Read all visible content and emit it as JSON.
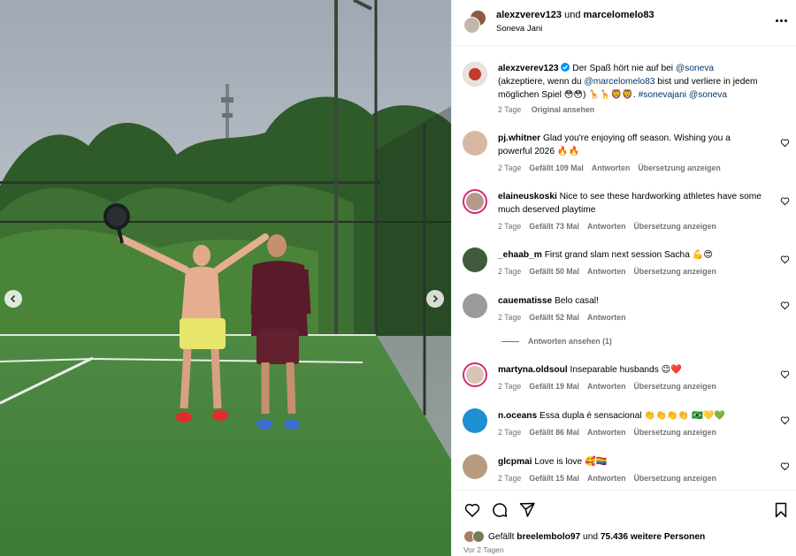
{
  "post": {
    "header": {
      "user1": "alexzverev123",
      "joiner": "und",
      "user2": "marcelomelo83",
      "location": "Soneva Jani"
    },
    "caption": {
      "user": "alexzverev123",
      "text1": "Der Spaß hört nie auf bei",
      "mention1": "@soneva",
      "text2": "(akzeptiere, wenn du",
      "mention2": "@marcelomelo83",
      "text3": "bist und verliere in jedem möglichen Spiel 😳😳) 🦒🦒🦁🦁.",
      "hashtag": "#sonevajani",
      "mention3": "@soneva",
      "time": "2 Tage",
      "action": "Original ansehen"
    },
    "comments": [
      {
        "user": "pj.whitner",
        "text": "Glad you're enjoying off season. Wishing you a powerful 2026 🔥🔥",
        "time": "2 Tage",
        "likes": "Gefällt 109 Mal",
        "reply": "Antworten",
        "translate": "Übersetzung anzeigen"
      },
      {
        "user": "elaineuskoski",
        "text": "Nice to see these hardworking athletes have some much deserved playtime",
        "time": "2 Tage",
        "likes": "Gefällt 73 Mal",
        "reply": "Antworten",
        "translate": "Übersetzung anzeigen"
      },
      {
        "user": "_ehaab_m",
        "text": "First grand slam next session Sacha 💪😍",
        "time": "2 Tage",
        "likes": "Gefällt 50 Mal",
        "reply": "Antworten",
        "translate": "Übersetzung anzeigen"
      },
      {
        "user": "cauematisse",
        "text": "Belo casal!",
        "time": "2 Tage",
        "likes": "Gefällt 52 Mal",
        "reply": "Antworten",
        "translate": ""
      },
      {
        "user": "martyna.oldsoul",
        "text": "Inseparable husbands 😉❤️",
        "time": "2 Tage",
        "likes": "Gefällt 19 Mal",
        "reply": "Antworten",
        "translate": "Übersetzung anzeigen"
      },
      {
        "user": "n.oceans",
        "text": "Essa dupla é sensacional 👏👏👏👏 🇧🇷💛💚",
        "time": "2 Tage",
        "likes": "Gefällt 86 Mal",
        "reply": "Antworten",
        "translate": "Übersetzung anzeigen"
      },
      {
        "user": "glcpmai",
        "text": "Love is love 🥰🏳️‍🌈",
        "time": "2 Tage",
        "likes": "Gefällt 15 Mal",
        "reply": "Antworten",
        "translate": "Übersetzung anzeigen"
      }
    ],
    "view_replies": "Antworten ansehen (1)",
    "footer": {
      "liked_prefix": "Gefällt",
      "liked_user": "breelembolo97",
      "liked_mid": "und",
      "liked_others": "75.436 weitere Personen",
      "date": "Vor 2 Tagen"
    },
    "icons": {
      "like": "heart-icon",
      "comment": "comment-icon",
      "share": "share-icon",
      "save": "bookmark-icon",
      "more": "more-icon",
      "verified": "verified-icon"
    },
    "colors": {
      "link": "#00376b",
      "verified": "#0095f6",
      "meta": "#737373"
    }
  }
}
